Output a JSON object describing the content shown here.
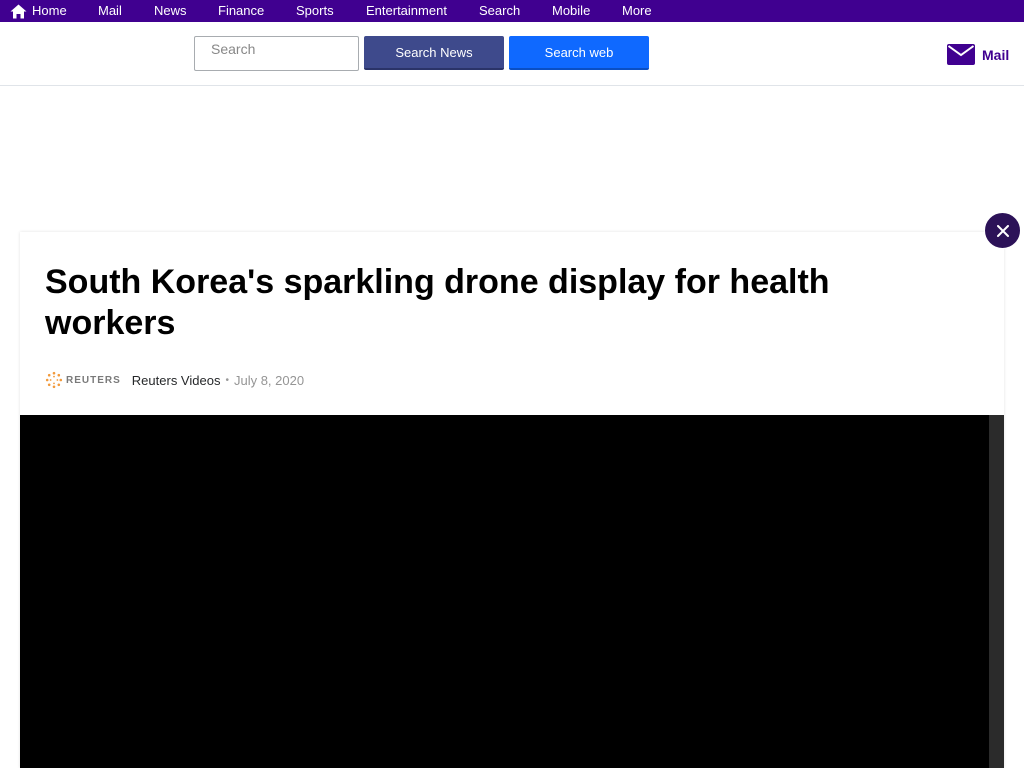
{
  "nav": {
    "items": [
      {
        "label": "Home",
        "icon": "home-icon"
      },
      {
        "label": "Mail"
      },
      {
        "label": "News"
      },
      {
        "label": "Finance"
      },
      {
        "label": "Sports"
      },
      {
        "label": "Entertainment"
      },
      {
        "label": "Search"
      },
      {
        "label": "Mobile"
      },
      {
        "label": "More"
      }
    ]
  },
  "header": {
    "search_placeholder": "Search",
    "search_news_label": "Search News",
    "search_web_label": "Search web",
    "mail_label": "Mail"
  },
  "article": {
    "title": "South Korea's sparkling drone display for health workers",
    "provider_logo_text": "REUTERS",
    "provider": "Reuters Videos",
    "separator": "•",
    "date": "July 8, 2020"
  },
  "colors": {
    "nav_bg": "#400090",
    "search_news_bg": "#3e4a8c",
    "search_web_bg": "#0f69ff",
    "close_bg": "#2c1258"
  }
}
